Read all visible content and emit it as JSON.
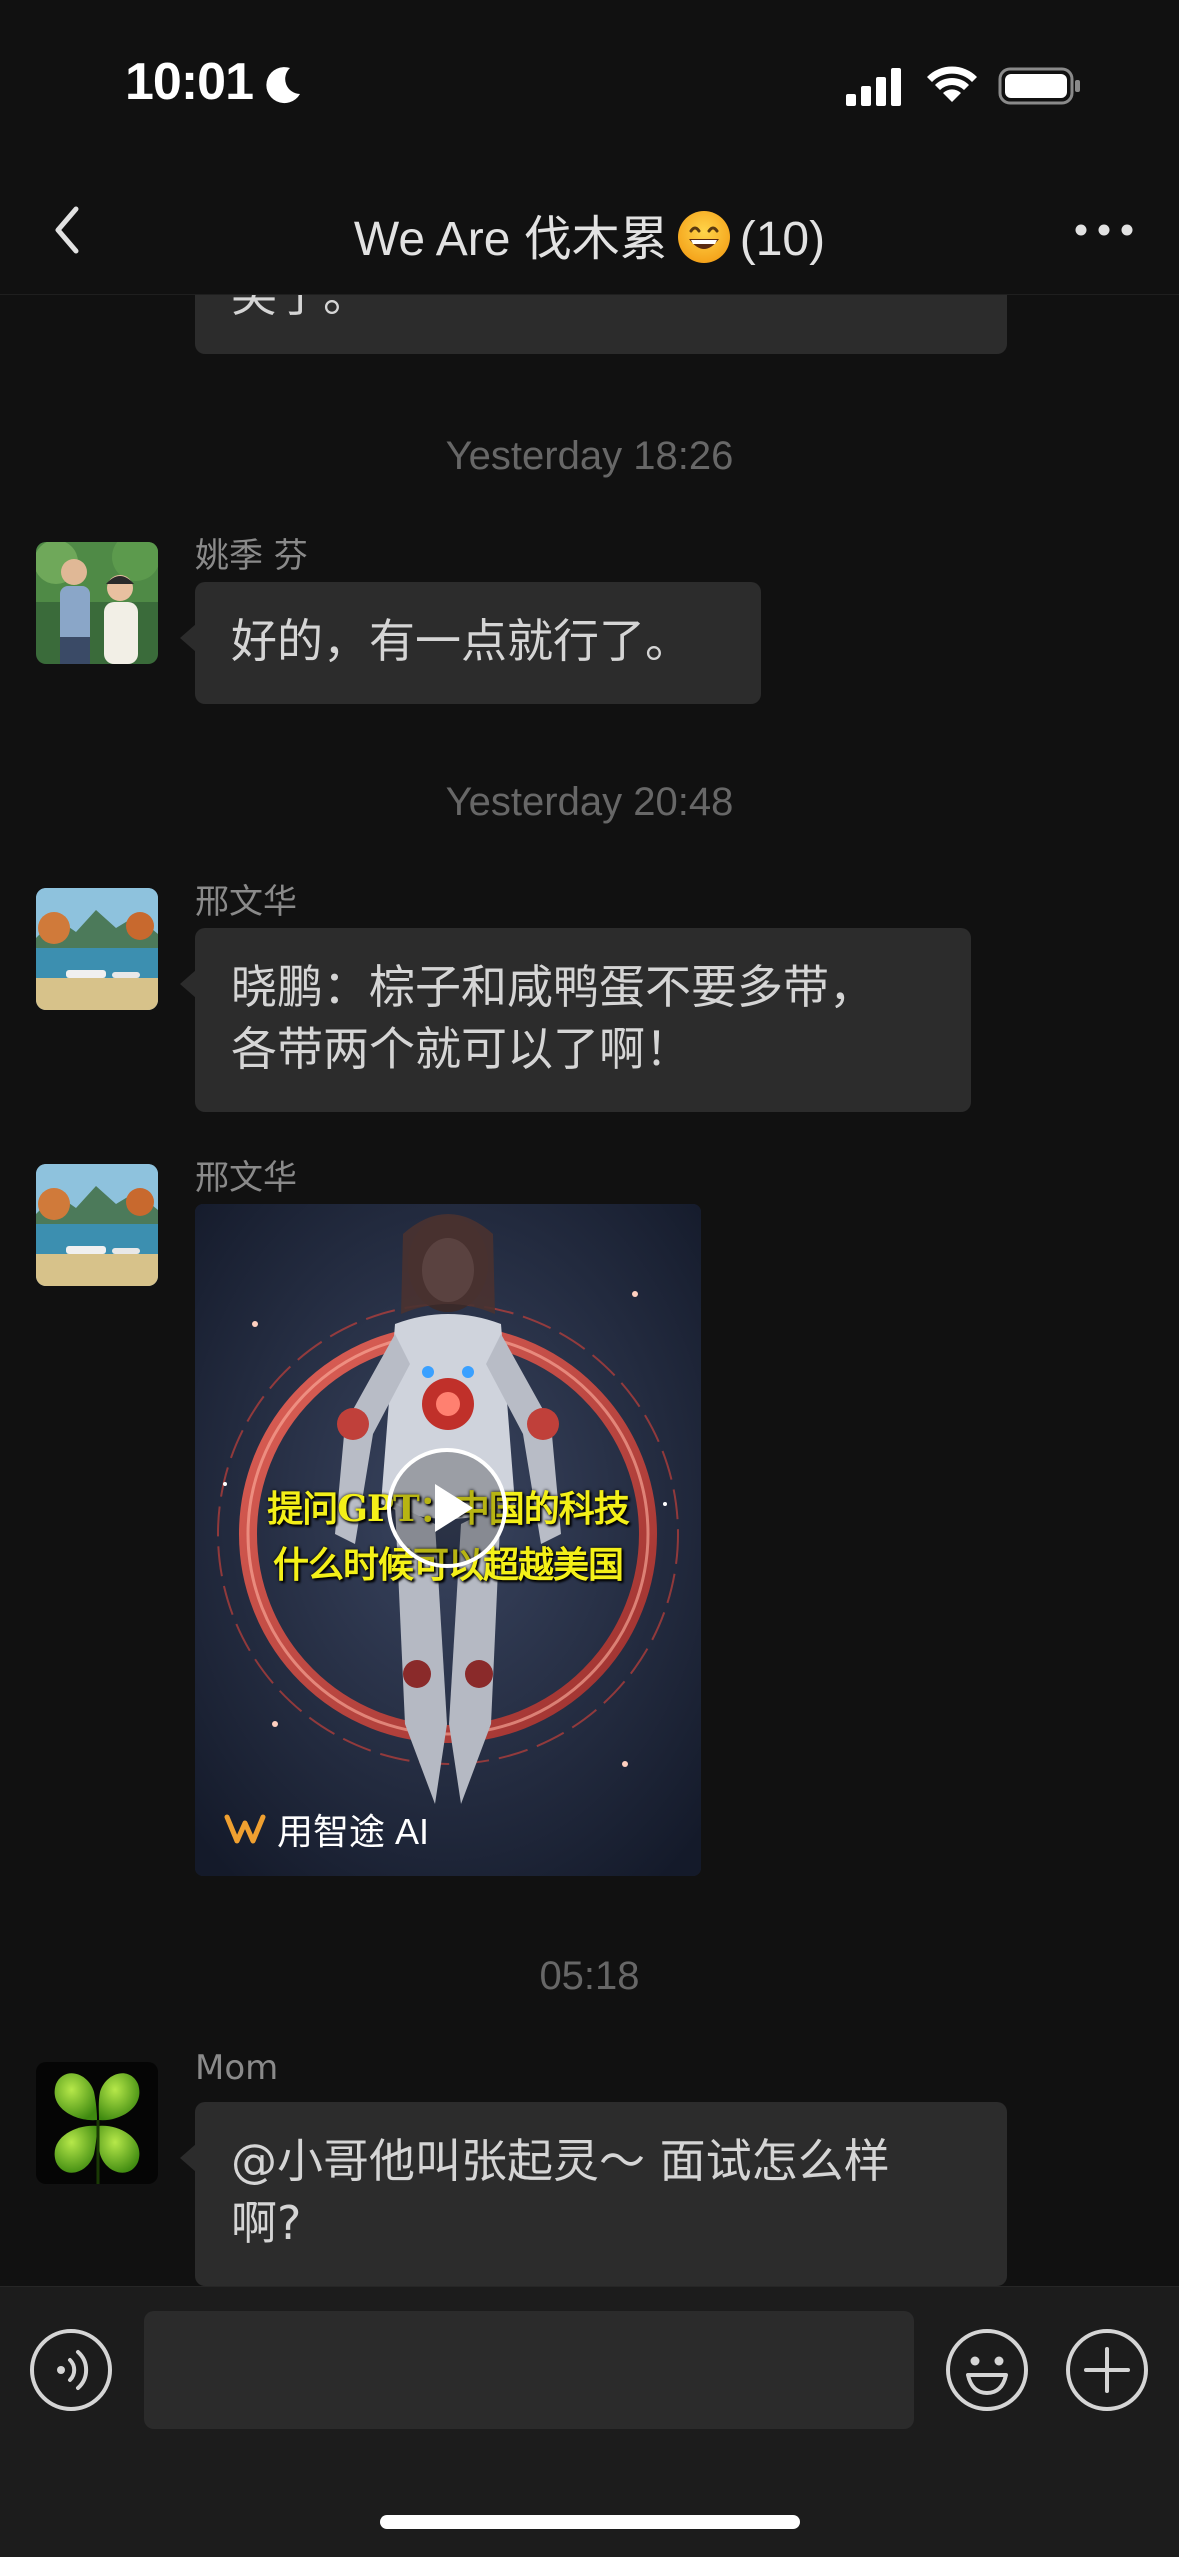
{
  "status_bar": {
    "time": "10:01",
    "icons": [
      "moon-icon",
      "cellular-signal-icon",
      "wifi-icon",
      "battery-icon"
    ]
  },
  "nav": {
    "title_prefix": "We Are 伐木累",
    "title_emoji": "grinning-face-emoji",
    "member_count": "(10)",
    "back_icon": "chevron-left-icon",
    "more_icon": "more-dots-icon"
  },
  "messages": {
    "partial": {
      "text": "笑了。"
    },
    "ts1": "Yesterday 18:26",
    "m1": {
      "sender": "姚季 芬",
      "text": "好的，有一点就行了。"
    },
    "ts2": "Yesterday 20:48",
    "m2": {
      "sender": "邢文华",
      "line1": "晓鹏：棕子和咸鸭蛋不要多带，",
      "line2": "各带两个就可以了啊！"
    },
    "m3": {
      "sender": "邢文华",
      "video_line1": "提问GPT：中国的科技",
      "video_line2": "什么时候可以超越美国",
      "brand": "用智途 AI"
    },
    "ts3": "05:18",
    "m4": {
      "sender": "Mom",
      "line1": "@小哥他叫张起灵～ 面试怎么样",
      "line2": "啊?"
    }
  },
  "input_bar": {
    "value": "",
    "placeholder": ""
  },
  "colors": {
    "background": "#111111",
    "bubble": "#2c2c2c",
    "input_bar": "#1c1c1c",
    "timestamp": "#676767",
    "sender": "#8a8a8a"
  }
}
